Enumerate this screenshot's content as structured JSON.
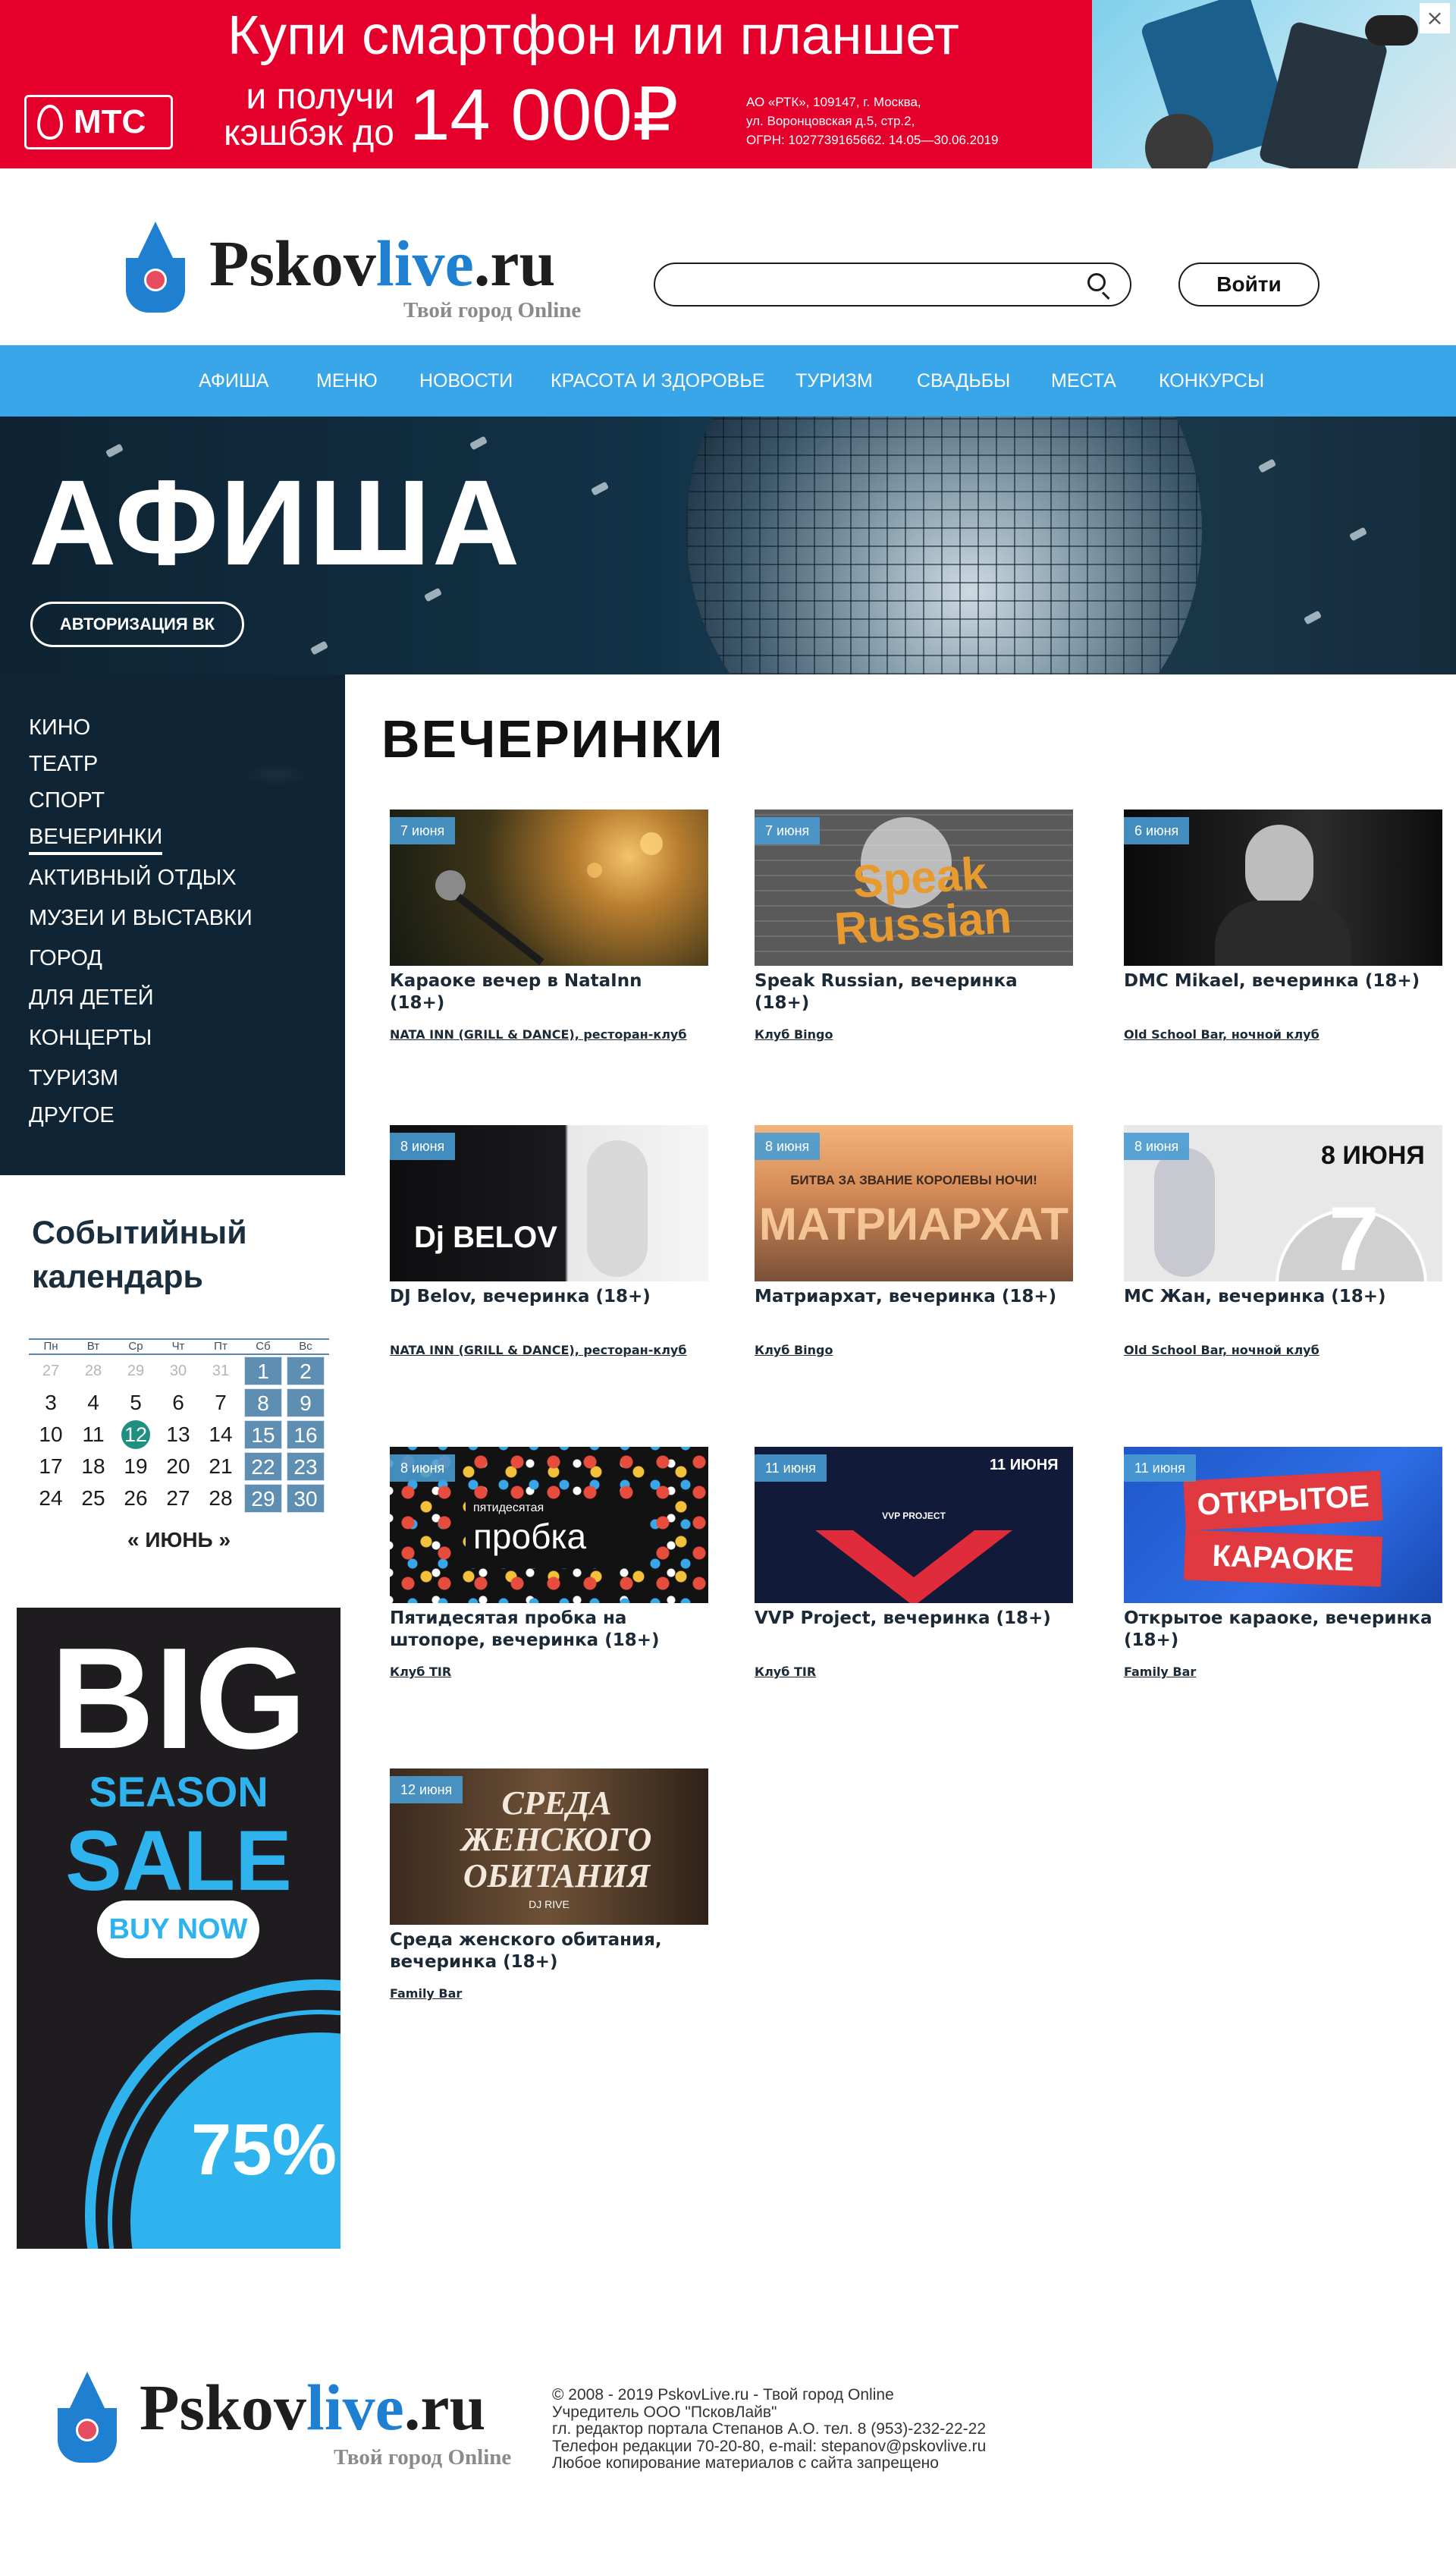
{
  "ad_banner": {
    "logo_text": "МТС",
    "title": "Купи смартфон или планшет",
    "subtitle_line1": "и получи",
    "subtitle_line2": "кэшбэк до",
    "amount": "14 000₽",
    "legal": [
      "АО «РТК», 109147, г. Москва,",
      "ул. Воронцовская д.5, стр.2,",
      "ОГРН: 1027739165662. 14.05—30.06.2019"
    ],
    "close_icon": "×"
  },
  "header": {
    "logo_main": "Pskov",
    "logo_live": "live",
    "logo_tld": ".ru",
    "tagline": "Твой город Online",
    "search_placeholder": "",
    "login_label": "Войти"
  },
  "nav": {
    "items": [
      "АФИША",
      "МЕНЮ",
      "НОВОСТИ",
      "КРАСОТА И ЗДОРОВЬЕ",
      "ТУРИЗМ",
      "СВАДЬБЫ",
      "МЕСТА",
      "КОНКУРСЫ"
    ]
  },
  "hero": {
    "title": "АФИША",
    "vk_button": "АВТОРИЗАЦИЯ ВК"
  },
  "sidebar": {
    "items": [
      "КИНО",
      "ТЕАТР",
      "СПОРТ",
      "ВЕЧЕРИНКИ",
      "АКТИВНЫЙ ОТДЫХ",
      "МУЗЕИ И ВЫСТАВКИ",
      "ГОРОД",
      "ДЛЯ ДЕТЕЙ",
      "КОНЦЕРТЫ",
      "ТУРИЗМ",
      "ДРУГОЕ"
    ],
    "active": "ВЕЧЕРИНКИ"
  },
  "calendar": {
    "title": "Событийный календарь",
    "weekdays": [
      "Пн",
      "Вт",
      "Ср",
      "Чт",
      "Пт",
      "Сб",
      "Вс"
    ],
    "weeks": [
      [
        "27",
        "28",
        "29",
        "30",
        "31",
        "1",
        "2"
      ],
      [
        "3",
        "4",
        "5",
        "6",
        "7",
        "8",
        "9"
      ],
      [
        "10",
        "11",
        "12",
        "13",
        "14",
        "15",
        "16"
      ],
      [
        "17",
        "18",
        "19",
        "20",
        "21",
        "22",
        "23"
      ],
      [
        "24",
        "25",
        "26",
        "27",
        "28",
        "29",
        "30"
      ]
    ],
    "today": "12",
    "month": "ИЮНЬ",
    "prev_icon": "«",
    "next_icon": "»"
  },
  "side_ad": {
    "big": "BIG",
    "season": "SEASON",
    "sale": "SALE",
    "button": "BUY NOW",
    "percent": "75%"
  },
  "section": {
    "title": "ВЕЧЕРИНКИ"
  },
  "events": [
    {
      "date": "7 июня",
      "title": "Караоке вечер в NataInn (18+)",
      "place": "NATA INN (GRILL & DANCE), ресторан-клуб"
    },
    {
      "date": "7 июня",
      "title": "Speak Russian, вечеринка (18+)",
      "place": "Клуб Bingo",
      "overlay": "Speak Russian"
    },
    {
      "date": "6 июня",
      "title": "DMC Mikael, вечеринка (18+)",
      "place": "Old School Bar, ночной клуб"
    },
    {
      "date": "8 июня",
      "title": "DJ Belov, вечеринка (18+)",
      "place": "NATA INN (GRILL & DANCE), ресторан-клуб",
      "overlay": "Dj BELOV"
    },
    {
      "date": "8 июня",
      "title": "Матриархат, вечеринка (18+)",
      "place": "Клуб Bingo",
      "overlay": "МАТРИАРХАТ",
      "overlay2": "БИТВА ЗА ЗВАНИЕ КОРОЛЕВЫ НОЧИ!"
    },
    {
      "date": "8 июня",
      "title": "MC Жан, вечеринка (18+)",
      "place": "Old School Bar, ночной клуб",
      "overlay": "8 ИЮНЯ",
      "overlay2": "7"
    },
    {
      "date": "8 июня",
      "title": "Пятидесятая пробка на штопоре, вечеринка (18+)",
      "place": "Клуб TIR",
      "overlay": "пробка",
      "overlay2": "пятидесятая"
    },
    {
      "date": "11 июня",
      "title": "VVP Project, вечеринка (18+)",
      "place": "Клуб TIR",
      "overlay": "11 ИЮНЯ",
      "overlay2": "VVP PROJECT"
    },
    {
      "date": "11 июня",
      "title": "Открытое караоке, вечеринка (18+)",
      "place": "Family Bar",
      "overlay": "ОТКРЫТОЕ",
      "overlay2": "КАРАОКЕ"
    },
    {
      "date": "12 июня",
      "title": "Среда женского обитания, вечеринка (18+)",
      "place": "Family Bar",
      "overlay": "СРЕДА ЖЕНСКОГО ОБИТАНИЯ",
      "overlay2": "DJ RIVE"
    }
  ],
  "footer": {
    "tagline": "Твой город Online",
    "lines": [
      "© 2008 - 2019 PskovLive.ru - Твой город Online",
      "Учредитель ООО \"ПсковЛайв\"",
      "гл. редактор портала Степанов А.О. тел. 8 (953)-232-22-22",
      "Телефон редакции 70-20-80, e-mail: stepanov@pskovlive.ru",
      "Любое копирование материалов с сайта запрещено"
    ]
  }
}
